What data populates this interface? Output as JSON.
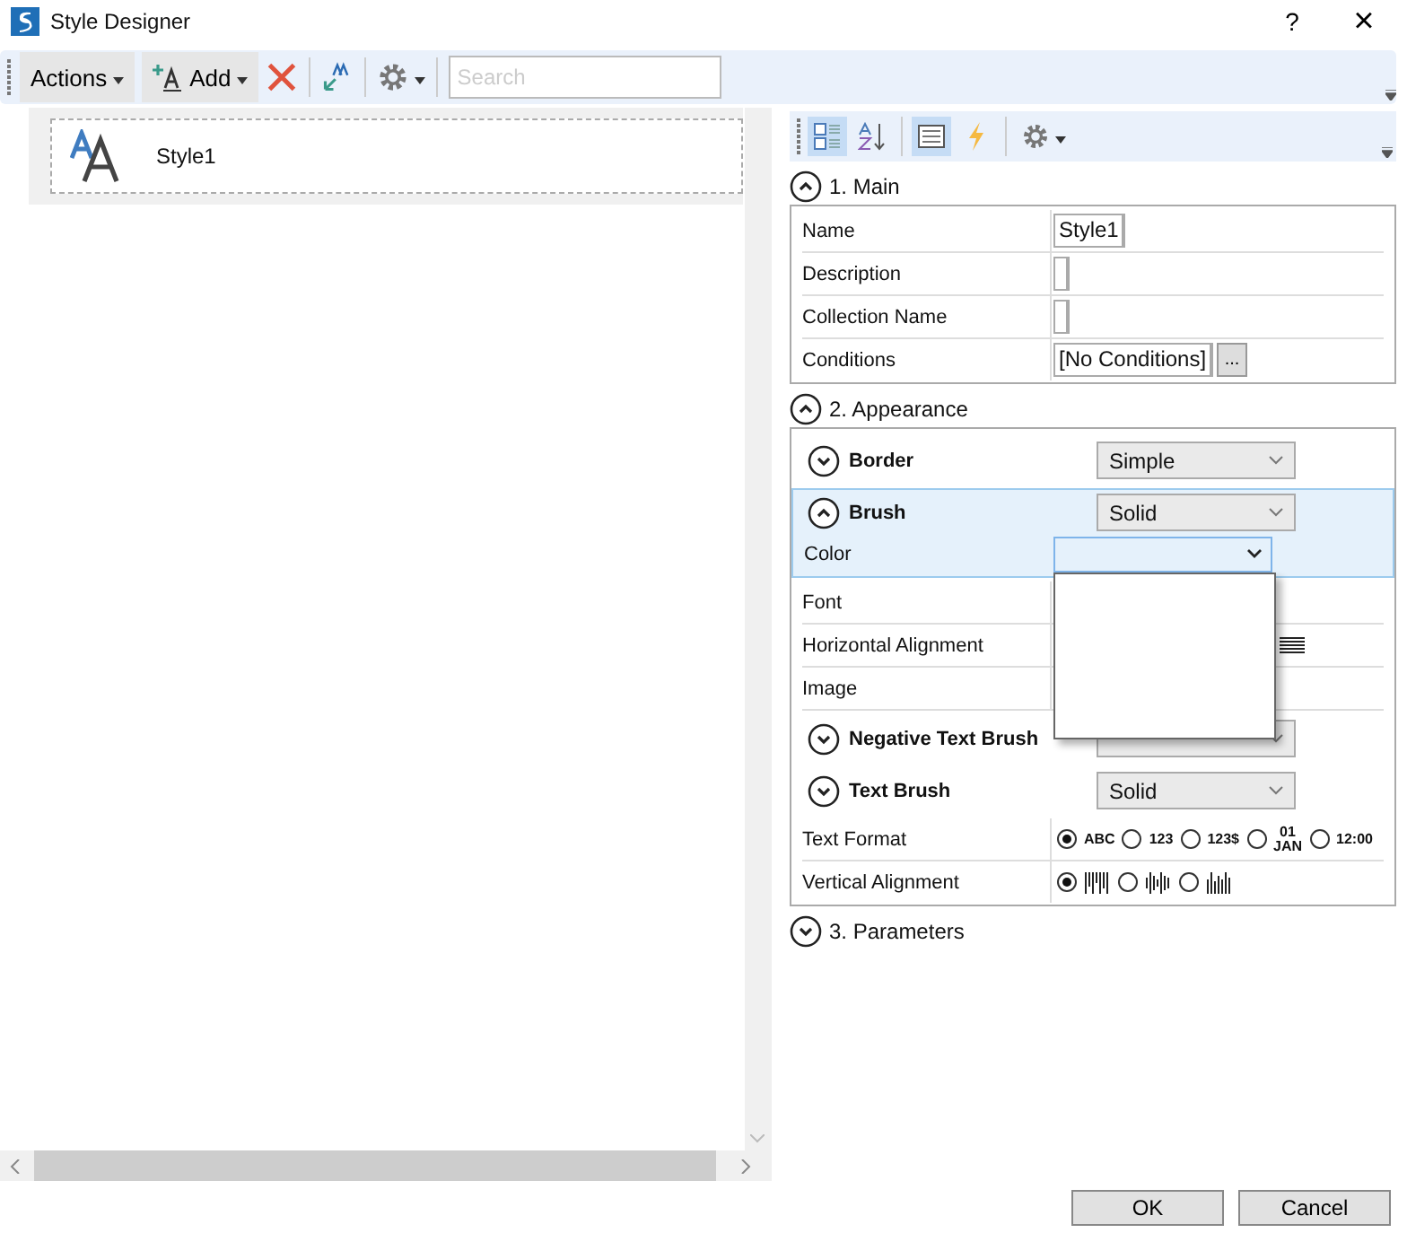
{
  "window": {
    "title": "Style Designer",
    "help": "?",
    "close": "×"
  },
  "toolbar": {
    "actions": "Actions",
    "add": "Add",
    "search": {
      "placeholder": "Search"
    }
  },
  "styles": [
    {
      "name": "Style1",
      "selected": true
    }
  ],
  "property_toolbar": [
    {
      "kind": "categorized",
      "selected": true
    },
    {
      "kind": "sort",
      "selected": false
    },
    {
      "kind": "properties",
      "selected": true
    },
    {
      "kind": "events",
      "selected": false
    },
    {
      "kind": "settings",
      "selected": false
    }
  ],
  "sections": [
    {
      "title": "1. Main",
      "expanded": true,
      "rows": [
        {
          "kind": "text",
          "label": "Name",
          "value": "Style1"
        },
        {
          "kind": "text",
          "label": "Description"
        },
        {
          "kind": "text",
          "label": "Collection Name"
        },
        {
          "kind": "button",
          "label": "Conditions",
          "value": "[No Conditions]",
          "button": "..."
        }
      ]
    },
    {
      "title": "2. Appearance",
      "expanded": true,
      "rows": [
        {
          "kind": "group",
          "label": "Border",
          "expanded": false,
          "selected": false,
          "value": "Simple"
        },
        {
          "kind": "group",
          "label": "Brush",
          "expanded": true,
          "selected": true,
          "value": "Solid",
          "children": [
            {
              "kind": "combo",
              "label": "Color",
              "open": true
            }
          ]
        },
        {
          "kind": "text",
          "label": "Font"
        },
        {
          "kind": "align",
          "label": "Horizontal Alignment"
        },
        {
          "kind": "text",
          "label": "Image"
        },
        {
          "kind": "group",
          "label": "Negative Text Brush",
          "expanded": false,
          "selected": false
        },
        {
          "kind": "group",
          "label": "Text Brush",
          "expanded": false,
          "selected": false,
          "value": "Solid"
        },
        {
          "kind": "radio",
          "label": "Text Format",
          "options": [
            {
              "label": "ABC",
              "selected": true
            },
            {
              "label": "123",
              "selected": false
            },
            {
              "label": "123$",
              "selected": false
            },
            {
              "label": "01 JAN",
              "selected": false
            },
            {
              "label": "12:00",
              "selected": false
            }
          ]
        },
        {
          "kind": "radio-icons",
          "label": "Vertical Alignment",
          "options": [
            {
              "kind": "top",
              "selected": true
            },
            {
              "kind": "center",
              "selected": false
            },
            {
              "kind": "bottom",
              "selected": false
            }
          ]
        }
      ]
    },
    {
      "title": "3. Parameters",
      "expanded": false
    }
  ],
  "buttons": [
    {
      "label": "OK"
    },
    {
      "label": "Cancel"
    }
  ]
}
